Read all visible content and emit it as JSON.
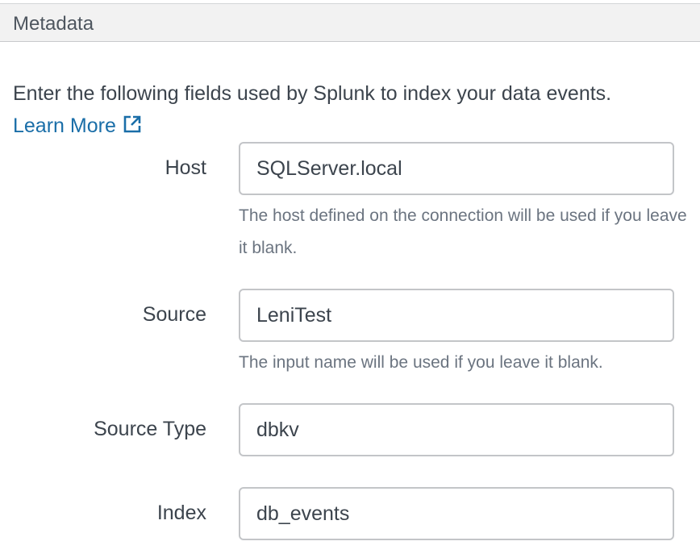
{
  "section": {
    "title": "Metadata"
  },
  "intro": {
    "text": "Enter the following fields used by Splunk to index your data events. ",
    "link_label": "Learn More",
    "link_icon": "external-link-icon",
    "link_color": "#1a6ea8"
  },
  "fields": {
    "host": {
      "label": "Host",
      "value": "SQLServer.local",
      "help": "The host defined on the connection will be used if you leave it blank."
    },
    "source": {
      "label": "Source",
      "value": "LeniTest",
      "help": "The input name will be used if you leave it blank."
    },
    "source_type": {
      "label": "Source Type",
      "value": "dbkv"
    },
    "index": {
      "label": "Index",
      "value": "db_events"
    }
  }
}
